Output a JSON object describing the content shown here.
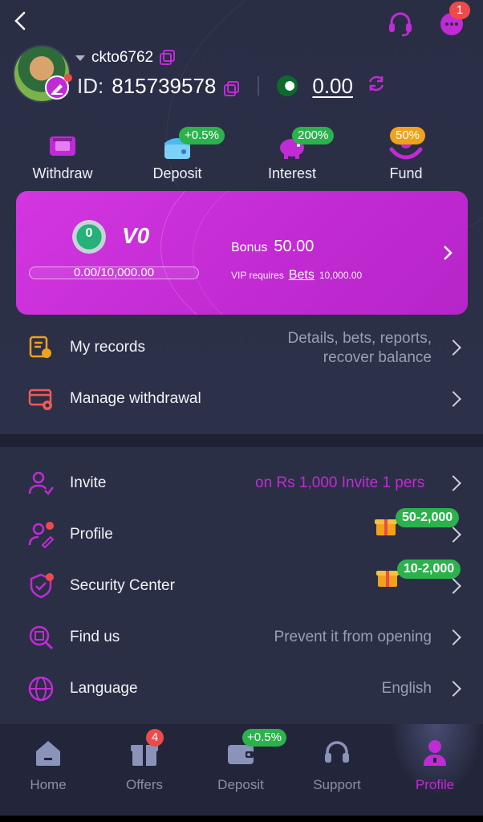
{
  "header": {
    "username": "ckto6762",
    "id_label": "ID:",
    "user_id": "815739578",
    "balance": "0.00",
    "notification_count": "1"
  },
  "quick_actions": [
    {
      "label": "Withdraw",
      "icon": "withdraw-icon",
      "badge": ""
    },
    {
      "label": "Deposit",
      "icon": "wallet-icon",
      "badge": "+0.5%"
    },
    {
      "label": "Interest",
      "icon": "piggy-bank-icon",
      "badge": "200%"
    },
    {
      "label": "Fund",
      "icon": "fund-hands-icon",
      "badge": "50%"
    }
  ],
  "vip": {
    "medal_level": "0",
    "level": "V0",
    "progress_text": "0.00/10,000.00",
    "progress_fraction": 0.0,
    "bonus_label": "Bonus",
    "bonus_value": "50.00",
    "requires_label": "VIP requires",
    "bets_label": "Bets",
    "bets_value": "10,000.00"
  },
  "records": {
    "my_records_label": "My records",
    "my_records_hint_1": "Details, bets, reports,",
    "my_records_hint_2": "recover balance",
    "manage_withdrawal_label": "Manage withdrawal"
  },
  "menu": {
    "invite_label": "Invite",
    "invite_hint": "on Rs 1,000  Invite 1 pers",
    "profile_label": "Profile",
    "profile_reward": "50-2,000",
    "security_label": "Security Center",
    "security_reward": "10-2,000",
    "findus_label": "Find us",
    "findus_hint": "Prevent it from opening",
    "language_label": "Language",
    "language_value": "English"
  },
  "nav": {
    "home": "Home",
    "offers": "Offers",
    "offers_badge": "4",
    "deposit": "Deposit",
    "deposit_badge": "+0.5%",
    "support": "Support",
    "profile": "Profile"
  },
  "colors": {
    "accent": "#c02bd6",
    "background": "#2b2f45",
    "green_badge": "#2bb24c",
    "red_badge": "#ef4a4a",
    "orange_badge": "#f0a21a"
  }
}
